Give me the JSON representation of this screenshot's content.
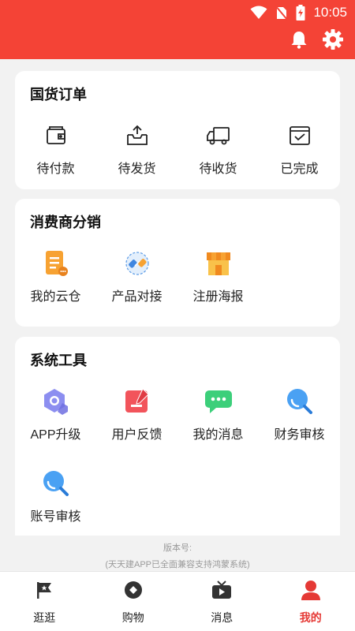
{
  "status_bar": {
    "time": "10:05",
    "icons": [
      "wifi-icon",
      "no-sim-icon",
      "battery-charging-icon"
    ]
  },
  "header": {
    "icons": [
      "bell-icon",
      "gear-icon"
    ]
  },
  "orders": {
    "title": "国货订单",
    "items": [
      {
        "label": "待付款",
        "icon": "wallet-icon"
      },
      {
        "label": "待发货",
        "icon": "outbox-icon"
      },
      {
        "label": "待收货",
        "icon": "truck-icon"
      },
      {
        "label": "已完成",
        "icon": "completed-box-icon"
      }
    ]
  },
  "distribution": {
    "title": "消费商分销",
    "items": [
      {
        "label": "我的云仓",
        "icon": "cloud-warehouse-icon"
      },
      {
        "label": "产品对接",
        "icon": "product-docking-icon"
      },
      {
        "label": "注册海报",
        "icon": "store-poster-icon"
      }
    ]
  },
  "tools": {
    "title": "系统工具",
    "items": [
      {
        "label": "APP升级",
        "icon": "hexagon-upgrade-icon"
      },
      {
        "label": "用户反馈",
        "icon": "feedback-icon"
      },
      {
        "label": "我的消息",
        "icon": "chat-icon"
      },
      {
        "label": "财务审核",
        "icon": "magnifier-icon"
      },
      {
        "label": "账号审核",
        "icon": "magnifier-icon"
      }
    ]
  },
  "version": {
    "label": "版本号:",
    "note": "(天天建APP已全面兼容支持鸿蒙系统)"
  },
  "tabbar": {
    "items": [
      {
        "label": "逛逛",
        "icon": "flag-icon"
      },
      {
        "label": "购物",
        "icon": "shopping-icon"
      },
      {
        "label": "消息",
        "icon": "tv-message-icon"
      },
      {
        "label": "我的",
        "icon": "user-icon",
        "active": true
      }
    ]
  },
  "colors": {
    "primary": "#f44336",
    "active_tab": "#e53935",
    "background": "#f2f2f2"
  }
}
